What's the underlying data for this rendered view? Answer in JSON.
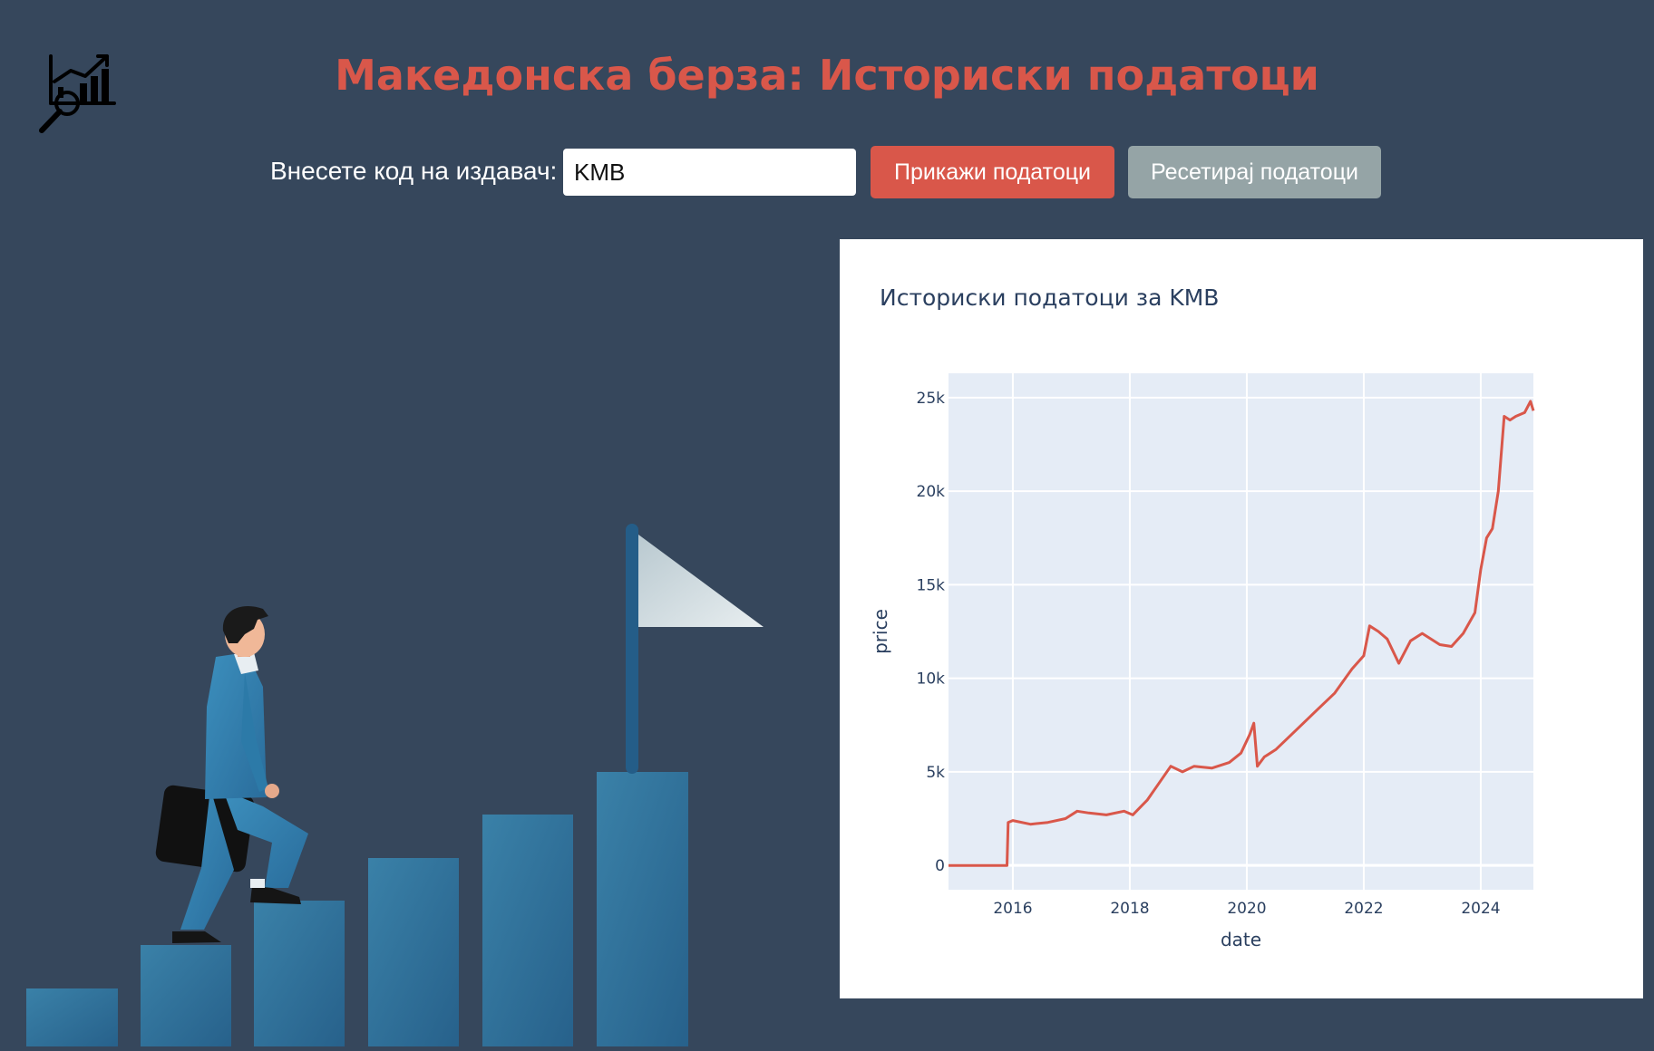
{
  "header": {
    "title": "Македонска берза: Историски податоци",
    "logo_icon": "stock-chart-magnifier-icon"
  },
  "form": {
    "label": "Внесете код на издавач:",
    "issuer_code": "KMB",
    "show_button_label": "Прикажи податоци",
    "reset_button_label": "Ресетирај податоци"
  },
  "colors": {
    "background": "#36475c",
    "accent": "#d9574a",
    "reset_button": "#95a4a6",
    "plot_background": "#e5ecf6",
    "line": "#d9574a"
  },
  "illustration": {
    "description_icon": "businessman-climbing-steps-to-flag-illustration"
  },
  "chart_data": {
    "type": "line",
    "title": "Историски податоци за KMB",
    "xlabel": "date",
    "ylabel": "price",
    "xlim": [
      2014.9,
      2024.9
    ],
    "ylim": [
      -1300,
      26300
    ],
    "x_ticks": [
      2016,
      2018,
      2020,
      2022,
      2024
    ],
    "y_ticks": [
      0,
      5000,
      10000,
      15000,
      20000,
      25000
    ],
    "y_tick_labels": [
      "0",
      "5k",
      "10k",
      "15k",
      "20k",
      "25k"
    ],
    "grid": true,
    "series": [
      {
        "color": "#d9574a",
        "x": [
          2014.9,
          2015.2,
          2015.6,
          2015.9,
          2015.92,
          2016.0,
          2016.3,
          2016.6,
          2016.9,
          2017.1,
          2017.3,
          2017.6,
          2017.9,
          2018.05,
          2018.3,
          2018.5,
          2018.7,
          2018.9,
          2019.1,
          2019.4,
          2019.7,
          2019.9,
          2020.05,
          2020.12,
          2020.18,
          2020.3,
          2020.5,
          2020.7,
          2020.9,
          2021.2,
          2021.5,
          2021.8,
          2022.0,
          2022.1,
          2022.25,
          2022.4,
          2022.6,
          2022.8,
          2023.0,
          2023.3,
          2023.5,
          2023.7,
          2023.9,
          2024.0,
          2024.1,
          2024.2,
          2024.3,
          2024.4,
          2024.5,
          2024.6,
          2024.75,
          2024.85,
          2024.9
        ],
        "y": [
          0,
          0,
          0,
          0,
          2300,
          2400,
          2200,
          2300,
          2500,
          2900,
          2800,
          2700,
          2900,
          2700,
          3500,
          4400,
          5300,
          5000,
          5300,
          5200,
          5500,
          6000,
          7000,
          7600,
          5300,
          5800,
          6200,
          6800,
          7400,
          8300,
          9200,
          10500,
          11200,
          12800,
          12500,
          12100,
          10800,
          12000,
          12400,
          11800,
          11700,
          12400,
          13500,
          15800,
          17500,
          18000,
          20000,
          24000,
          23800,
          24000,
          24200,
          24800,
          24300
        ]
      }
    ]
  }
}
